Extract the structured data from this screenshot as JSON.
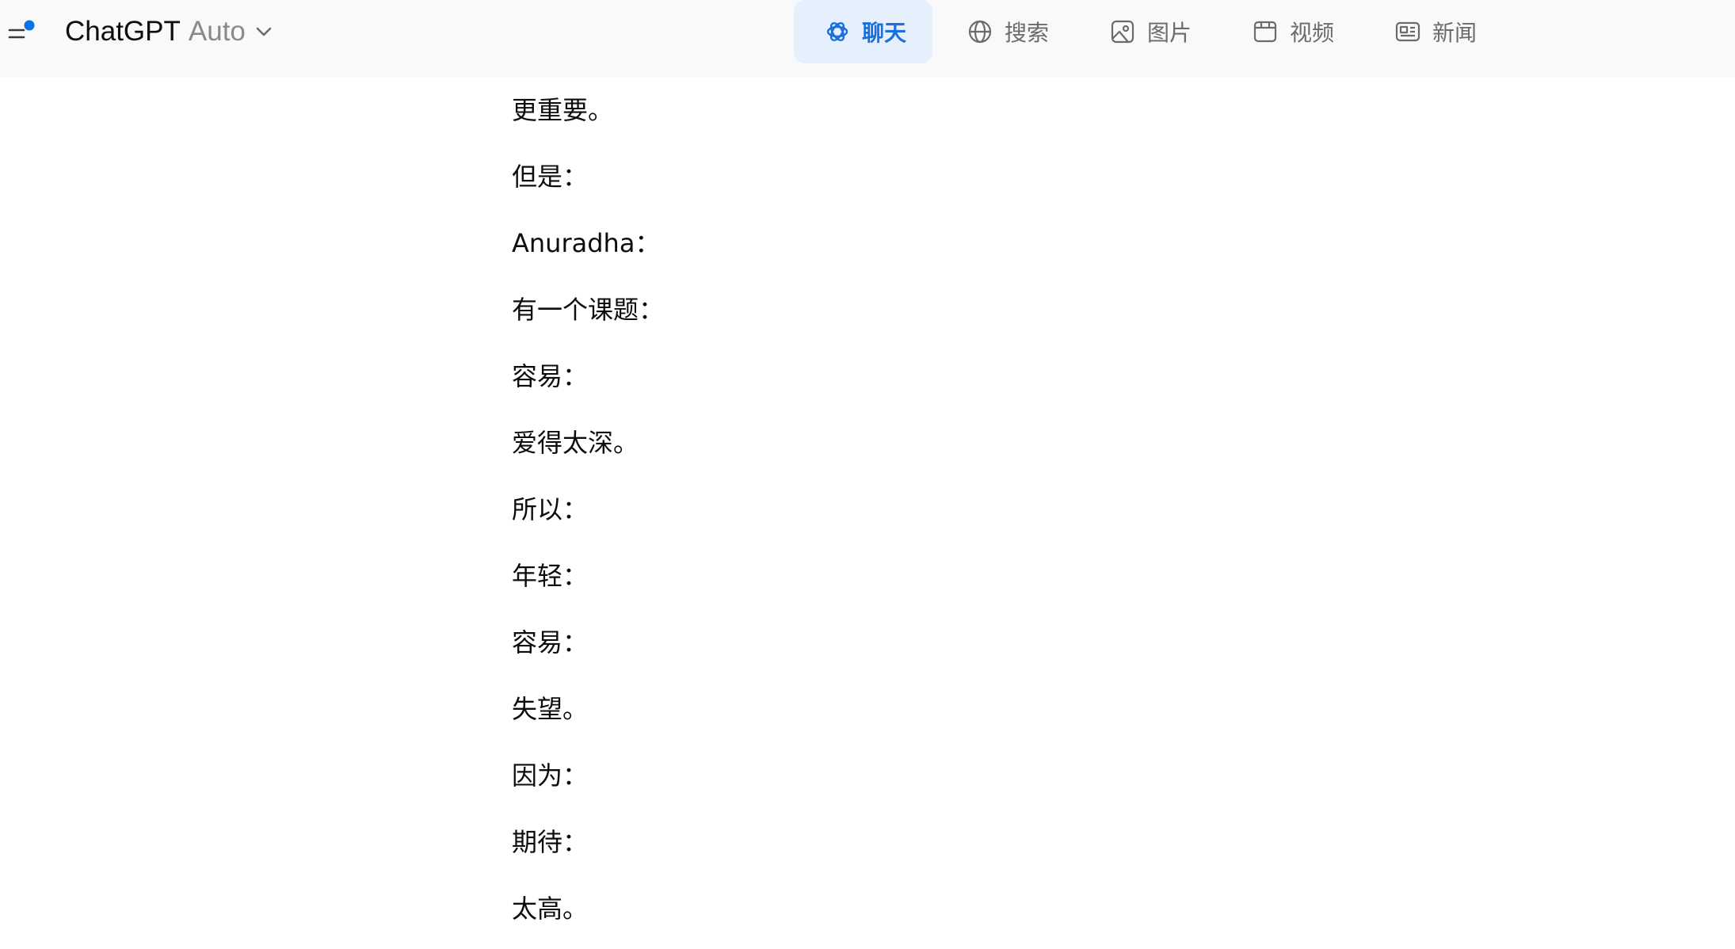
{
  "header": {
    "app_name": "ChatGPT",
    "model_name": "Auto",
    "accent_color": "#1a6fdb",
    "notification_dot_color": "#0a72e8"
  },
  "tabs": [
    {
      "label": "聊天",
      "icon": "chat-swirl-icon",
      "active": true
    },
    {
      "label": "搜索",
      "icon": "globe-icon",
      "active": false
    },
    {
      "label": "图片",
      "icon": "image-icon",
      "active": false
    },
    {
      "label": "视频",
      "icon": "video-icon",
      "active": false
    },
    {
      "label": "新闻",
      "icon": "news-icon",
      "active": false
    }
  ],
  "message": {
    "lines": [
      "更重要。",
      "但是：",
      "Anuradha：",
      "有一个课题：",
      "容易：",
      "爱得太深。",
      "所以：",
      "年轻：",
      "容易：",
      "失望。",
      "因为：",
      "期待：",
      "太高。"
    ]
  }
}
